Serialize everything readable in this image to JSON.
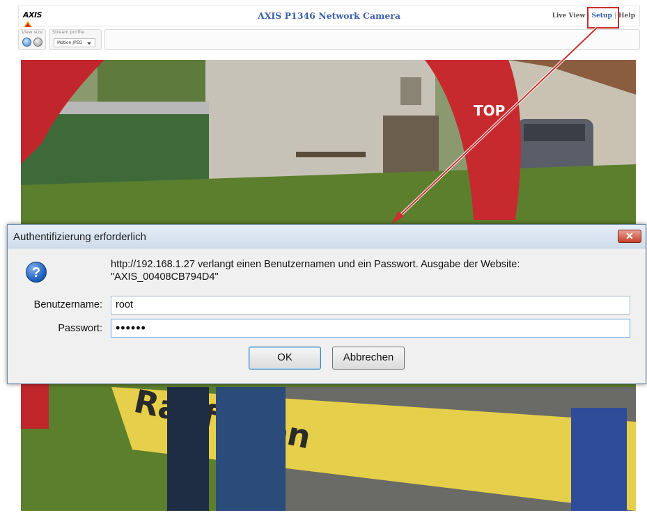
{
  "header": {
    "logo_text": "AXIS",
    "title": "AXIS P1346 Network Camera",
    "links": [
      {
        "label": "Live View",
        "active": false
      },
      {
        "label": "Setup",
        "active": true
      },
      {
        "label": "Help",
        "active": false
      }
    ]
  },
  "toolbar": {
    "view_size_label": "View size",
    "stream_profile_label": "Stream profile",
    "stream_profile_value": "Motion JPEG"
  },
  "dialog": {
    "title": "Authentifizierung erforderlich",
    "close_label": "✕",
    "message": "http://192.168.1.27 verlangt einen Benutzernamen und ein Passwort. Ausgabe der Website: \"AXIS_00408CB794D4\"",
    "username_label": "Benutzername:",
    "username_value": "root",
    "password_label": "Passwort:",
    "password_value": "••••••",
    "ok_label": "OK",
    "cancel_label": "Abbrechen"
  },
  "colors": {
    "accent_blue": "#3a5fa6",
    "highlight_red": "#cc2b2b",
    "close_red": "#c8402b"
  }
}
